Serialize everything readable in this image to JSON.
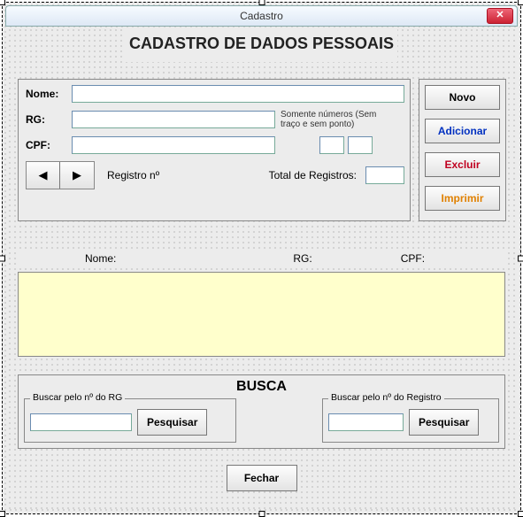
{
  "window": {
    "title": "Cadastro",
    "close_glyph": "✕"
  },
  "heading": "CADASTRO DE DADOS PESSOAIS",
  "form": {
    "nome_label": "Nome:",
    "nome_value": "",
    "rg_label": "RG:",
    "rg_value": "",
    "rg_hint": "Somente números (Sem traço e sem ponto)",
    "cpf_label": "CPF:",
    "cpf_value": "",
    "cpf_box1": "",
    "cpf_box2": "",
    "prev_glyph": "◀",
    "next_glyph": "▶",
    "registro_label": "Registro nº",
    "registro_value": "",
    "total_label": "Total de Registros:",
    "total_value": ""
  },
  "side": {
    "novo": "Novo",
    "adicionar": "Adicionar",
    "excluir": "Excluir",
    "imprimir": "Imprimir"
  },
  "list": {
    "col_nome": "Nome:",
    "col_rg": "RG:",
    "col_cpf": "CPF:",
    "rows": []
  },
  "busca": {
    "title": "BUSCA",
    "group_rg_label": "Buscar pelo nº do RG",
    "group_rg_value": "",
    "group_rg_btn": "Pesquisar",
    "group_reg_label": "Buscar pelo nº do Registro",
    "group_reg_value": "",
    "group_reg_btn": "Pesquisar"
  },
  "footer": {
    "fechar": "Fechar"
  }
}
